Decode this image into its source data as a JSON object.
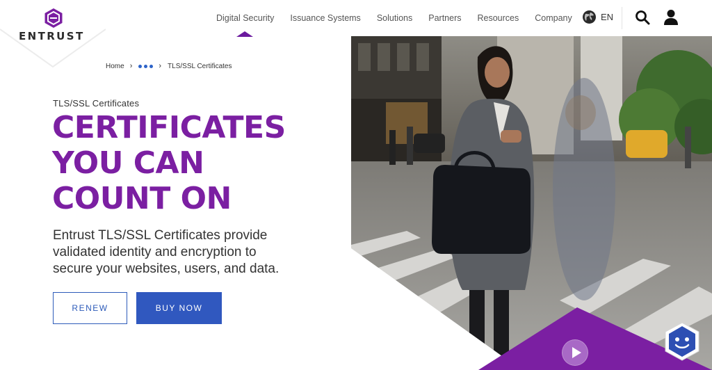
{
  "brand": {
    "logo_text": "ENTRUST",
    "accent": "#7b1fa2",
    "cta_blue": "#3058bf"
  },
  "nav": {
    "items": [
      {
        "label": "Digital Security",
        "active": true
      },
      {
        "label": "Issuance Systems"
      },
      {
        "label": "Solutions"
      },
      {
        "label": "Partners"
      },
      {
        "label": "Resources"
      },
      {
        "label": "Company"
      }
    ],
    "language": "EN",
    "icons": [
      "globe-icon",
      "search-icon",
      "user-icon"
    ]
  },
  "breadcrumb": {
    "home": "Home",
    "current": "TLS/SSL Certificates"
  },
  "hero": {
    "eyebrow": "TLS/SSL Certificates",
    "headline_lines": [
      "CERTIFICATES",
      "YOU CAN",
      "COUNT ON"
    ],
    "intro_lines": [
      "Entrust TLS/SSL Certificates provide",
      "validated identity and encryption to",
      "secure your websites, users, and data."
    ],
    "buttons": {
      "renew": "RENEW",
      "buy": "BUY NOW"
    }
  }
}
